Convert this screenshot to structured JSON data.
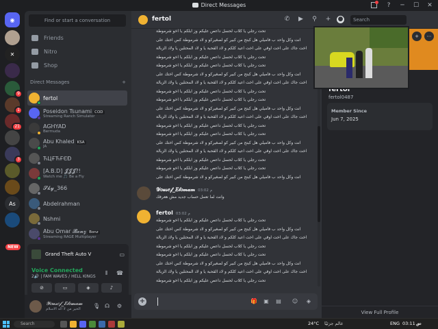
{
  "window": {
    "title": "Direct Messages"
  },
  "sidebar": {
    "search_label": "Find or start a conversation",
    "nav": [
      {
        "label": "Friends",
        "icon": "friends-icon"
      },
      {
        "label": "Nitro",
        "icon": "nitro-icon"
      },
      {
        "label": "Shop",
        "icon": "shop-icon"
      }
    ],
    "dm_header": "Direct Messages",
    "dm_add": "+",
    "dms": [
      {
        "name": "fertol",
        "sub": "",
        "tag": "",
        "color": "#f0b232",
        "status": "#23a55a"
      },
      {
        "name": "Poseidon Tsunami",
        "sub": "Streaming Ranch Simulator",
        "tag": "COD",
        "color": "#5865f2",
        "status": "#593695"
      },
      {
        "name": "AGHYAD",
        "sub": "Bermuda",
        "tag": "",
        "color": "#3a3a3a",
        "status": "#f0b232"
      },
      {
        "name": "Abu Khaled",
        "sub": "JA",
        "tag": "KSA",
        "color": "#4a4a4a",
        "status": "#23a55a"
      },
      {
        "name": "ЋЦҒЋҒЄĐ",
        "sub": "",
        "tag": "",
        "color": "#555555",
        "status": "#80848e"
      },
      {
        "name": "[A.B.D] 𝓙𝓙𝓙?!",
        "sub": "Watch me 🎵 Be a Fly",
        "tag": "",
        "color": "#7a3a3a",
        "status": "#23a55a"
      },
      {
        "name": "𝓢𝓴𝔂_366",
        "sub": "",
        "tag": "",
        "color": "#666666",
        "status": "#80848e"
      },
      {
        "name": "Abdelrahman",
        "sub": "",
        "tag": "",
        "color": "#3a5a7a",
        "status": "#80848e"
      },
      {
        "name": "Nshmi",
        "sub": "",
        "tag": "",
        "color": "#7a6a3a",
        "status": "#80848e"
      },
      {
        "name": "Abu Omar 𝓑𝓸𝓷𝔃",
        "sub": "Streaming RAGE Multiplayer",
        "tag": "Bonz",
        "color": "#4a4a6a",
        "status": "#593695"
      }
    ]
  },
  "activity": {
    "game": "Grand Theft Auto V",
    "voice_title": "Voice Connected",
    "voice_sub": "2🔊 | FAM WAVES / HELL KINGS"
  },
  "user": {
    "name": "𝒴𝑜𝓊𝓈𝑒𝒻_𝐸𝓁𝑜𝓂𝒶𝓂",
    "status": "الخير من لا أله الاسلام"
  },
  "chat": {
    "name": "fertol",
    "search_placeholder": "Search",
    "text_lines": [
      "تحت رجلي يا كلاب لحسل داعص عليكم وز ابلكم يا اخو شرموطة",
      "انت وكل واحد ب فاميلي هل كبتح من كبير كو لصغيركو و لاد شرموطة كس اختك على",
      "اخت جاك على اخت اوقي على اخت اعيد كلكم و لاد القحبة يا و لاد المحتلين يا ولاد الزبالة",
      "تحت رجلي يا كلاب لحسل داعص عليكم وز ابلكم يا اخو شرموطة"
    ],
    "messages": [
      {
        "author": "𝒴𝑜𝓊𝓈𝑒𝒻_𝐸𝓁𝑜𝓂𝒶𝓂",
        "time": "03:02 م",
        "text": "وانت لما تعمل حساب جديد مش هعرفك"
      },
      {
        "author": "fertol",
        "time": "03:02 م"
      }
    ]
  },
  "profile": {
    "name": "fertol",
    "handle": "fertol0487",
    "member_since_label": "Member Since",
    "member_since": "Jun 7, 2025",
    "view_full": "View Full Profile"
  },
  "taskbar": {
    "search": "Search",
    "weather": "24°C",
    "weather_sub": "عالم جزئيًا",
    "lang": "ENG",
    "time": "03:11 م",
    "date": "ص"
  },
  "colors": {
    "accent": "#5865f2",
    "online": "#23a55a",
    "danger": "#f23f43",
    "banner": "#e08a1f"
  }
}
